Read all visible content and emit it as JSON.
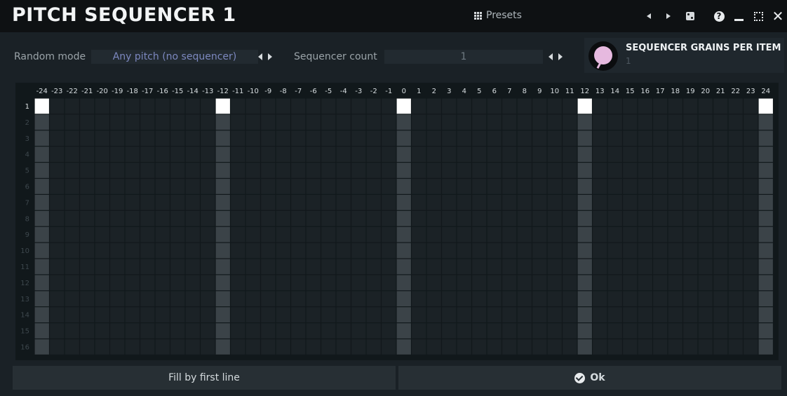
{
  "window": {
    "title": "PITCH SEQUENCER 1",
    "presets_label": "Presets"
  },
  "controls": {
    "random_mode_label": "Random mode",
    "random_mode_value": "Any pitch (no sequencer)",
    "sequencer_count_label": "Sequencer count",
    "sequencer_count_value": "1",
    "knob_title": "SEQUENCER GRAINS PER ITEM",
    "knob_value": "1"
  },
  "grid": {
    "columns": [
      "-24",
      "-23",
      "-22",
      "-21",
      "-20",
      "-19",
      "-18",
      "-17",
      "-16",
      "-15",
      "-14",
      "-13",
      "-12",
      "-11",
      "-10",
      "-9",
      "-8",
      "-7",
      "-6",
      "-5",
      "-4",
      "-3",
      "-2",
      "-1",
      "0",
      "1",
      "2",
      "3",
      "4",
      "5",
      "6",
      "7",
      "8",
      "9",
      "10",
      "11",
      "12",
      "13",
      "14",
      "15",
      "16",
      "17",
      "18",
      "19",
      "20",
      "21",
      "22",
      "23",
      "24"
    ],
    "rows": [
      "1",
      "2",
      "3",
      "4",
      "5",
      "6",
      "7",
      "8",
      "9",
      "10",
      "11",
      "12",
      "13",
      "14",
      "15",
      "16"
    ],
    "active_row": "1",
    "highlight_columns": [
      "-24",
      "-12",
      "0",
      "12",
      "24"
    ],
    "colors": {
      "active": "#ffffff",
      "octave_column": "#3b4348",
      "cell": "#1b2226",
      "panel": "#11181b"
    }
  },
  "buttons": {
    "fill_label": "Fill by first line",
    "ok_label": "Ok"
  }
}
